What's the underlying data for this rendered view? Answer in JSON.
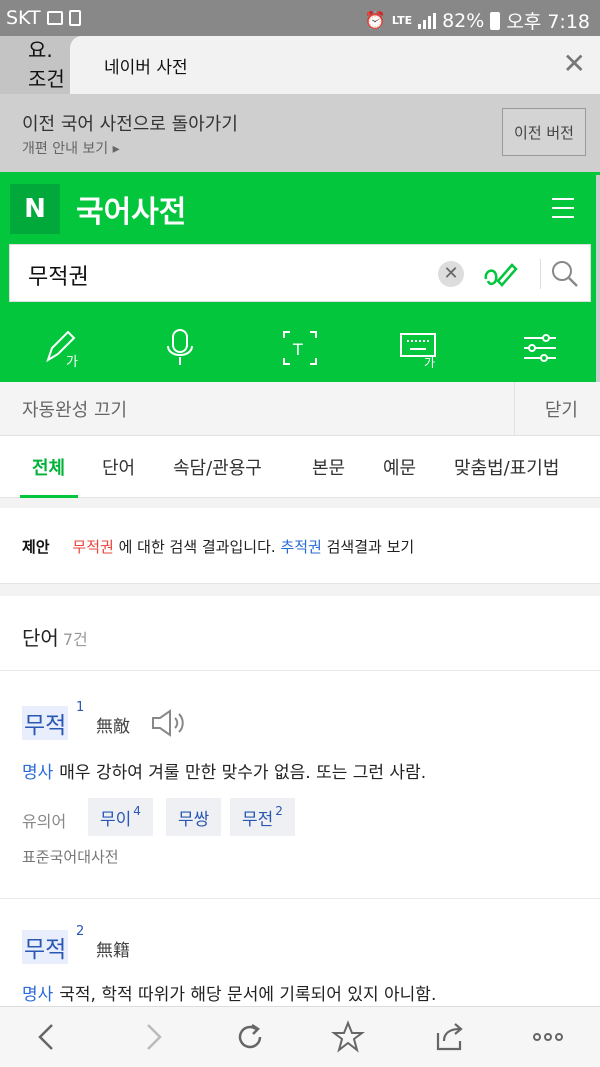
{
  "status_bar": {
    "carrier": "SKT",
    "network": "LTE",
    "battery": "82%",
    "time": "오후 7:18"
  },
  "tabs": {
    "previous_tab_text_1": "요.",
    "previous_tab_text_2": "조건",
    "current_tab_title": "네이버 사전"
  },
  "banner": {
    "message": "이전 국어 사전으로 돌아가기",
    "link": "개편 안내 보기 ▸",
    "button": "이전 버전"
  },
  "header": {
    "logo": "N",
    "title": "국어사전"
  },
  "search": {
    "query": "무적권"
  },
  "autocomplete": {
    "label": "자동완성 끄기",
    "close": "닫기"
  },
  "categories": [
    {
      "label": "전체",
      "active": true
    },
    {
      "label": "단어"
    },
    {
      "label": "속담/관용구"
    },
    {
      "label": "본문"
    },
    {
      "label": "예문"
    },
    {
      "label": "맞춤법/표기법"
    }
  ],
  "suggestion": {
    "tag": "제안",
    "searched": "무적권",
    "mid": "에 대한 검색 결과입니다.",
    "alt": "추적권",
    "tail": "검색결과 보기"
  },
  "words_section": {
    "title": "단어",
    "count": "7건",
    "entries": [
      {
        "word": "무적",
        "sup": "1",
        "hanja": "無敵",
        "pos": "명사",
        "definition": "매우 강하여 겨룰 만한 맞수가 없음. 또는 그런 사람.",
        "synonym_label": "유의어",
        "synonyms": [
          {
            "text": "무이",
            "sup": "4"
          },
          {
            "text": "무쌍",
            "sup": ""
          },
          {
            "text": "무전",
            "sup": "2"
          }
        ],
        "source": "표준국어대사전"
      },
      {
        "word": "무적",
        "sup": "2",
        "hanja": "無籍",
        "pos": "명사",
        "definition": "국적, 학적 따위가 해당 문서에 기록되어 있지 아니함."
      }
    ]
  },
  "colors": {
    "brand_green": "#03c63d",
    "link_blue": "#2a6bd8",
    "highlight_red": "#e8443a"
  }
}
